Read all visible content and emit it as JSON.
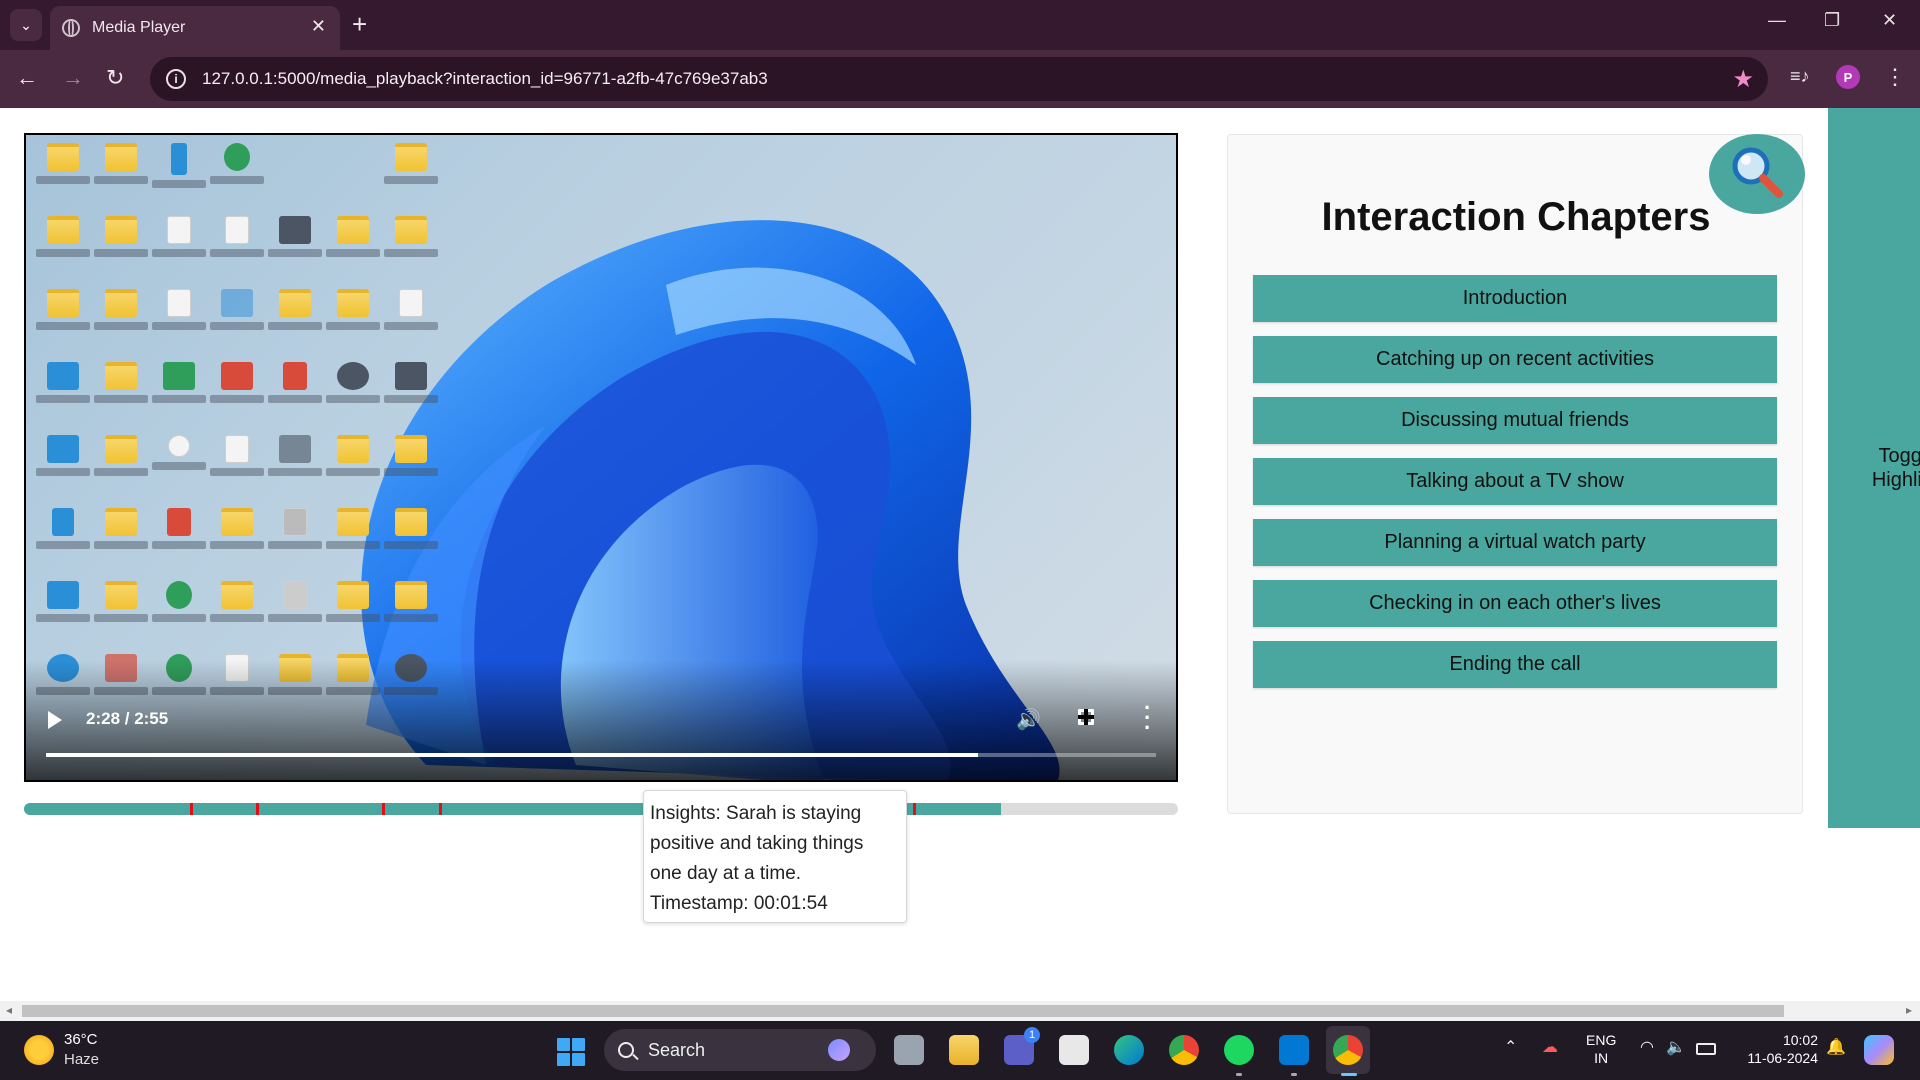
{
  "browser": {
    "tab_title": "Media Player",
    "new_tab": "+",
    "tab_close": "✕",
    "url": "127.0.0.1:5000/media_playback?interaction_id=96771-a2fb-47c769e37ab3",
    "profile_initial": "P",
    "minimize": "—",
    "restore": "❐",
    "close": "✕",
    "back": "←",
    "forward": "→",
    "reload": "↻",
    "menu": "⋮"
  },
  "video": {
    "time": "2:28 / 2:55",
    "progress_fraction": 0.84,
    "play_icon": "play-icon",
    "volume_icon": "volume-icon",
    "fullscreen_icon": "fullscreen-icon",
    "more_icon": "more-vert-icon"
  },
  "timeline": {
    "progress_fraction": 0.847,
    "marker_fractions": [
      0.144,
      0.201,
      0.31,
      0.36,
      0.77
    ],
    "fill_color": "#4aa79f",
    "marker_color": "#e0101a"
  },
  "tooltip": {
    "text": "Insights: Sarah is staying positive and taking things one day at a time. Timestamp: 00:01:54"
  },
  "chapters": {
    "title": "Interaction Chapters",
    "items": [
      "Introduction",
      "Catching up on recent activities",
      "Discussing mutual friends",
      "Talking about a TV show",
      "Planning a virtual watch party",
      "Checking in on each other's lives",
      "Ending the call"
    ],
    "accent_color": "#4aa79f"
  },
  "side_panel": {
    "label_line1": "Toggle",
    "label_line2": "Highligh"
  },
  "taskbar": {
    "temperature": "36°C",
    "weather": "Haze",
    "search_label": "Search",
    "lang_line1": "ENG",
    "lang_line2": "IN",
    "time": "10:02",
    "date": "11-06-2024",
    "teams_badge": "1"
  }
}
